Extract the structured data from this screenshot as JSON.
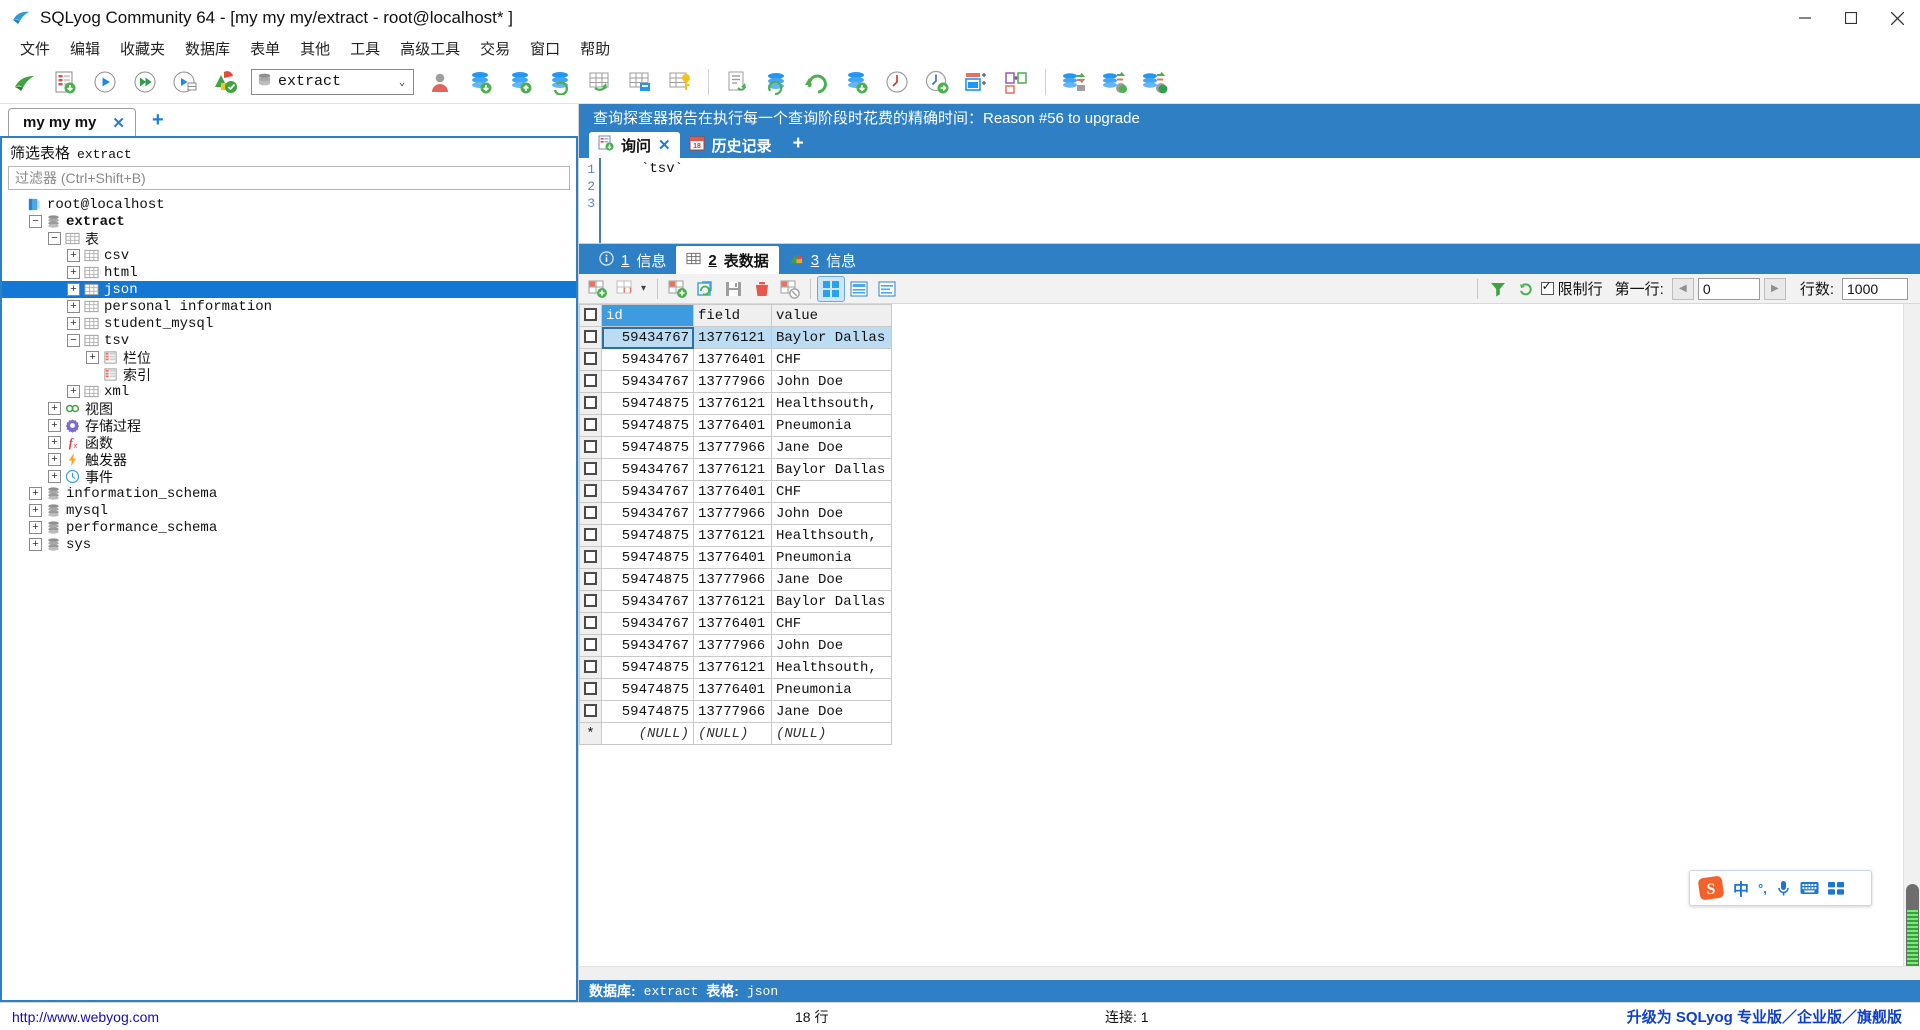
{
  "window": {
    "title": "SQLyog Community 64 - [my my my/extract - root@localhost* ]",
    "app_icon": "sqlyog-icon",
    "minimize": "−",
    "maximize": "▢",
    "close": "✕"
  },
  "menubar": {
    "items": [
      {
        "label": "文件",
        "name": "menu-file"
      },
      {
        "label": "编辑",
        "name": "menu-edit"
      },
      {
        "label": "收藏夹",
        "name": "menu-favorites"
      },
      {
        "label": "数据库",
        "name": "menu-database"
      },
      {
        "label": "表单",
        "name": "menu-table"
      },
      {
        "label": "其他",
        "name": "menu-other"
      },
      {
        "label": "工具",
        "name": "menu-tools"
      },
      {
        "label": "高级工具",
        "name": "menu-powertools"
      },
      {
        "label": "交易",
        "name": "menu-transaction"
      },
      {
        "label": "窗口",
        "name": "menu-window"
      },
      {
        "label": "帮助",
        "name": "menu-help"
      }
    ]
  },
  "toolbar": {
    "db_combo_value": "extract",
    "db_combo_arrow": "⌄",
    "buttons": [
      "new-connection-icon",
      "new-query-tab-icon",
      "execute-query-icon",
      "execute-all-queries-icon",
      "execute-query-and-save-icon",
      "stop-query-icon",
      "user-manager-icon",
      "import-database-icon",
      "export-database-icon",
      "sync-database-icon",
      "table-diagnostics-icon",
      "table-data-icon",
      "manage-index-icon",
      "query-builder-icon",
      "backup-database-icon",
      "restore-database-icon",
      "restore-from-sql-icon",
      "schedule-backup-icon",
      "schedule-job-icon",
      "copy-table-icon",
      "copy-database-icon",
      "migrate-data-icon",
      "database-sync-icon",
      "schema-sync-icon"
    ]
  },
  "left_pane": {
    "tab": {
      "label": "my my my",
      "close": "✕"
    },
    "new_tab": "+",
    "filter_title_cn": "筛选表格",
    "filter_title_obj": "extract",
    "filter_placeholder": "过滤器 (Ctrl+Shift+B)",
    "tree": [
      {
        "label": "root@localhost",
        "indent": 0,
        "expander": "",
        "icon": "host-icon",
        "bold": false,
        "selected": false,
        "cjk": false
      },
      {
        "label": "extract",
        "indent": 1,
        "expander": "−",
        "icon": "database-icon",
        "bold": true,
        "selected": false,
        "cjk": false
      },
      {
        "label": "表",
        "indent": 2,
        "expander": "−",
        "icon": "tables-folder-icon",
        "bold": false,
        "selected": false,
        "cjk": true
      },
      {
        "label": "csv",
        "indent": 3,
        "expander": "+",
        "icon": "table-icon",
        "bold": false,
        "selected": false,
        "cjk": false
      },
      {
        "label": "html",
        "indent": 3,
        "expander": "+",
        "icon": "table-icon",
        "bold": false,
        "selected": false,
        "cjk": false
      },
      {
        "label": "json",
        "indent": 3,
        "expander": "+",
        "icon": "table-icon",
        "bold": false,
        "selected": true,
        "cjk": false
      },
      {
        "label": "personal information",
        "indent": 3,
        "expander": "+",
        "icon": "table-icon",
        "bold": false,
        "selected": false,
        "cjk": false
      },
      {
        "label": "student_mysql",
        "indent": 3,
        "expander": "+",
        "icon": "table-icon",
        "bold": false,
        "selected": false,
        "cjk": false
      },
      {
        "label": "tsv",
        "indent": 3,
        "expander": "−",
        "icon": "table-icon",
        "bold": false,
        "selected": false,
        "cjk": false
      },
      {
        "label": "栏位",
        "indent": 4,
        "expander": "+",
        "icon": "columns-icon",
        "bold": false,
        "selected": false,
        "cjk": true
      },
      {
        "label": "索引",
        "indent": 4,
        "expander": "",
        "icon": "indexes-icon",
        "bold": false,
        "selected": false,
        "cjk": true
      },
      {
        "label": "xml",
        "indent": 3,
        "expander": "+",
        "icon": "table-icon",
        "bold": false,
        "selected": false,
        "cjk": false
      },
      {
        "label": "视图",
        "indent": 2,
        "expander": "+",
        "icon": "views-icon",
        "bold": false,
        "selected": false,
        "cjk": true
      },
      {
        "label": "存储过程",
        "indent": 2,
        "expander": "+",
        "icon": "procedures-icon",
        "bold": false,
        "selected": false,
        "cjk": true
      },
      {
        "label": "函数",
        "indent": 2,
        "expander": "+",
        "icon": "functions-icon",
        "bold": false,
        "selected": false,
        "cjk": true
      },
      {
        "label": "触发器",
        "indent": 2,
        "expander": "+",
        "icon": "triggers-icon",
        "bold": false,
        "selected": false,
        "cjk": true
      },
      {
        "label": "事件",
        "indent": 2,
        "expander": "+",
        "icon": "events-icon",
        "bold": false,
        "selected": false,
        "cjk": true
      },
      {
        "label": "information_schema",
        "indent": 1,
        "expander": "+",
        "icon": "database-icon",
        "bold": false,
        "selected": false,
        "cjk": false
      },
      {
        "label": "mysql",
        "indent": 1,
        "expander": "+",
        "icon": "database-icon",
        "bold": false,
        "selected": false,
        "cjk": false
      },
      {
        "label": "performance_schema",
        "indent": 1,
        "expander": "+",
        "icon": "database-icon",
        "bold": false,
        "selected": false,
        "cjk": false
      },
      {
        "label": "sys",
        "indent": 1,
        "expander": "+",
        "icon": "database-icon",
        "bold": false,
        "selected": false,
        "cjk": false
      }
    ]
  },
  "right_pane": {
    "ad_banner": "查询探查器报告在执行每一个查询阶段时花费的精确时间：Reason #56 to upgrade",
    "query_tabs": [
      {
        "label": "询问",
        "icon": "query-tab-icon",
        "active": true,
        "close": "✕"
      },
      {
        "label": "历史记录",
        "icon": "history-icon",
        "active": false,
        "close": ""
      }
    ],
    "query_tabs_add": "+",
    "editor": {
      "line_numbers": [
        "1",
        "2",
        "3"
      ],
      "code_line_1": "`tsv`"
    },
    "result_tabs": [
      {
        "num": "1",
        "label": "信息",
        "icon": "info-icon",
        "active": false
      },
      {
        "num": "2",
        "label": "表数据",
        "icon": "table-data-icon",
        "active": true
      },
      {
        "num": "3",
        "label": "信息",
        "icon": "chart-info-icon",
        "active": false
      }
    ],
    "grid_toolbar": {
      "buttons": [
        "insert-row-icon",
        "insert-blank-row-dropdown-icon",
        "duplicate-row-icon",
        "refresh-row-icon",
        "save-changes-icon",
        "delete-row-icon",
        "cancel-edit-icon",
        "grid-view-icon",
        "form-view-icon",
        "text-view-icon"
      ],
      "dropdown_caret": "▾",
      "filter_icon": "filter-icon",
      "refresh_icon": "refresh-icon",
      "limit_rows_label": "限制行",
      "limit_rows_checked": true,
      "first_row_label": "第一行:",
      "first_row_value": "0",
      "prev_arrow": "◀",
      "next_arrow": "▶",
      "row_count_label": "行数:",
      "row_count_value": "1000"
    },
    "grid": {
      "columns": [
        "id",
        "field",
        "value"
      ],
      "selected_column": "id",
      "rows": [
        {
          "id": "59434767",
          "field": "13776121",
          "value": "Baylor Dallas",
          "selected": true
        },
        {
          "id": "59434767",
          "field": "13776401",
          "value": "CHF",
          "selected": false
        },
        {
          "id": "59434767",
          "field": "13777966",
          "value": "John Doe",
          "selected": false
        },
        {
          "id": "59474875",
          "field": "13776121",
          "value": "Healthsouth,",
          "selected": false
        },
        {
          "id": "59474875",
          "field": "13776401",
          "value": "Pneumonia",
          "selected": false
        },
        {
          "id": "59474875",
          "field": "13777966",
          "value": "Jane Doe",
          "selected": false
        },
        {
          "id": "59434767",
          "field": "13776121",
          "value": "Baylor Dallas",
          "selected": false
        },
        {
          "id": "59434767",
          "field": "13776401",
          "value": "CHF",
          "selected": false
        },
        {
          "id": "59434767",
          "field": "13777966",
          "value": "John Doe",
          "selected": false
        },
        {
          "id": "59474875",
          "field": "13776121",
          "value": "Healthsouth,",
          "selected": false
        },
        {
          "id": "59474875",
          "field": "13776401",
          "value": "Pneumonia",
          "selected": false
        },
        {
          "id": "59474875",
          "field": "13777966",
          "value": "Jane Doe",
          "selected": false
        },
        {
          "id": "59434767",
          "field": "13776121",
          "value": "Baylor Dallas",
          "selected": false
        },
        {
          "id": "59434767",
          "field": "13776401",
          "value": "CHF",
          "selected": false
        },
        {
          "id": "59434767",
          "field": "13777966",
          "value": "John Doe",
          "selected": false
        },
        {
          "id": "59474875",
          "field": "13776121",
          "value": "Healthsouth,",
          "selected": false
        },
        {
          "id": "59474875",
          "field": "13776401",
          "value": "Pneumonia",
          "selected": false
        },
        {
          "id": "59474875",
          "field": "13777966",
          "value": "Jane Doe",
          "selected": false
        }
      ],
      "new_row": {
        "marker": "*",
        "id": "(NULL)",
        "field": "(NULL)",
        "value": "(NULL)"
      }
    },
    "db_status": {
      "db_label": "数据库:",
      "db_value": "extract",
      "table_label": "表格:",
      "table_value": "json"
    }
  },
  "ime": {
    "logo": "sogou-logo",
    "mode": "中",
    "punctuation": "°,",
    "mic": "mic-icon",
    "keyboard": "keyboard-icon",
    "apps": "apps-icon"
  },
  "statusbar": {
    "url": "http://www.webyog.com",
    "rows": "18 行",
    "connections": "连接: 1",
    "upgrade": "升级为 SQLyog 专业版／企业版／旗舰版"
  },
  "colors": {
    "accent_blue": "#2e7fc4",
    "select_blue": "#1577d4",
    "header_blue": "#3e9bdf",
    "link_blue": "#1140c8",
    "grid_selected_row": "#bcdcf4"
  }
}
